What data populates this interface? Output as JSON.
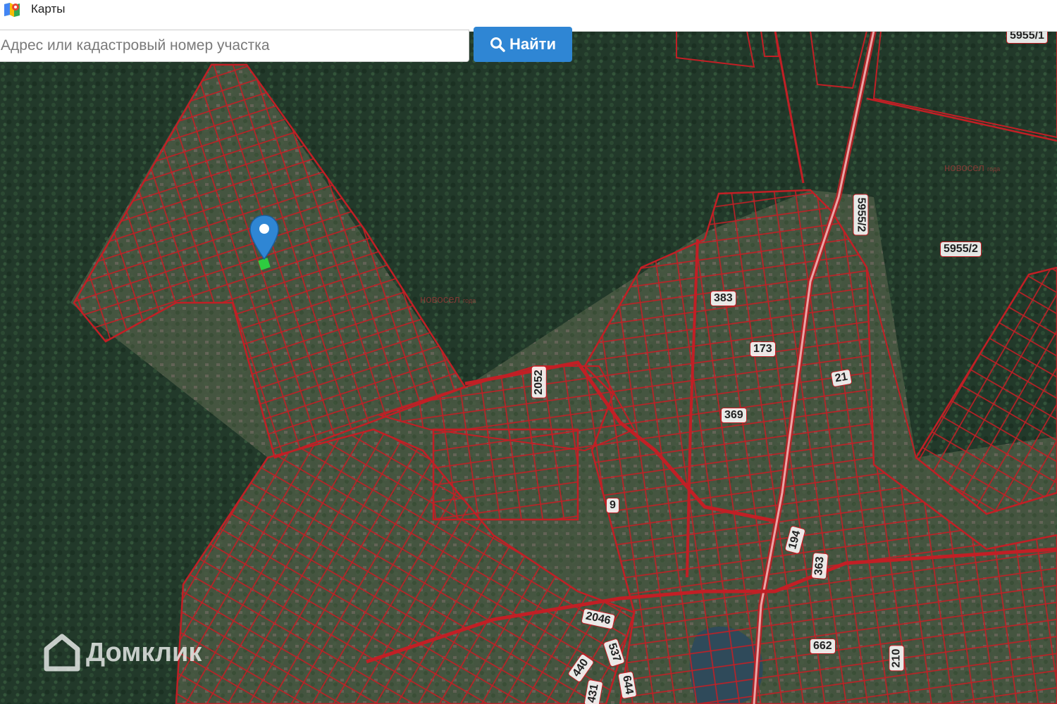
{
  "window": {
    "title": "Карты"
  },
  "search": {
    "placeholder": "Адрес или кадастровый номер участка",
    "button_label": "Найти"
  },
  "map": {
    "parcel_border_color": "#c21f25",
    "parcel_labels": [
      "5955/1",
      "5955/2",
      "5955/2",
      "383",
      "173",
      "21",
      "2052",
      "369",
      "9",
      "194",
      "363",
      "2046",
      "537",
      "440",
      "431",
      "644",
      "662",
      "210"
    ],
    "watermarks": {
      "brand": "Домклик",
      "overlay": "новосел",
      "overlay_small": "года"
    }
  },
  "icons": [
    "maps-app-icon",
    "search-icon",
    "location-pin-icon",
    "domclick-logo-icon"
  ]
}
